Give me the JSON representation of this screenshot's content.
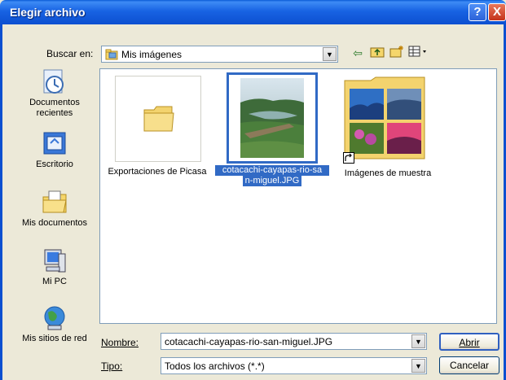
{
  "window": {
    "title": "Elegir archivo",
    "help_glyph": "?",
    "close_glyph": "X"
  },
  "toolbar": {
    "look_in_label": "Buscar en:",
    "look_in_value": "Mis imágenes",
    "icons": [
      "back-arrow-icon",
      "up-folder-icon",
      "new-folder-icon",
      "view-menu-icon"
    ]
  },
  "places": [
    {
      "label": "Documentos recientes",
      "icon": "recent-documents-icon"
    },
    {
      "label": "Escritorio",
      "icon": "desktop-icon"
    },
    {
      "label": "Mis documentos",
      "icon": "my-documents-icon"
    },
    {
      "label": "Mi PC",
      "icon": "my-computer-icon"
    },
    {
      "label": "Mis sitios de red",
      "icon": "network-places-icon"
    }
  ],
  "files": [
    {
      "label": "Exportaciones de Picasa",
      "type": "folder",
      "selected": false
    },
    {
      "label": "cotacachi-cayapas-rio-san-miguel.JPG",
      "label_line1": "cotacachi-cayapas-rio-sa",
      "label_line2": "n-miguel.JPG",
      "type": "image",
      "selected": true
    },
    {
      "label": "Imágenes de muestra",
      "type": "folder-shortcut",
      "selected": false
    }
  ],
  "form": {
    "name_label": "Nombre:",
    "name_value": "cotacachi-cayapas-rio-san-miguel.JPG",
    "type_label": "Tipo:",
    "type_value": "Todos los archivos (*.*)",
    "open_button": "Abrir",
    "cancel_button": "Cancelar"
  },
  "colors": {
    "titlebar": "#0c4fd0",
    "selection": "#316ac5",
    "dialog_bg": "#ece9d8"
  }
}
